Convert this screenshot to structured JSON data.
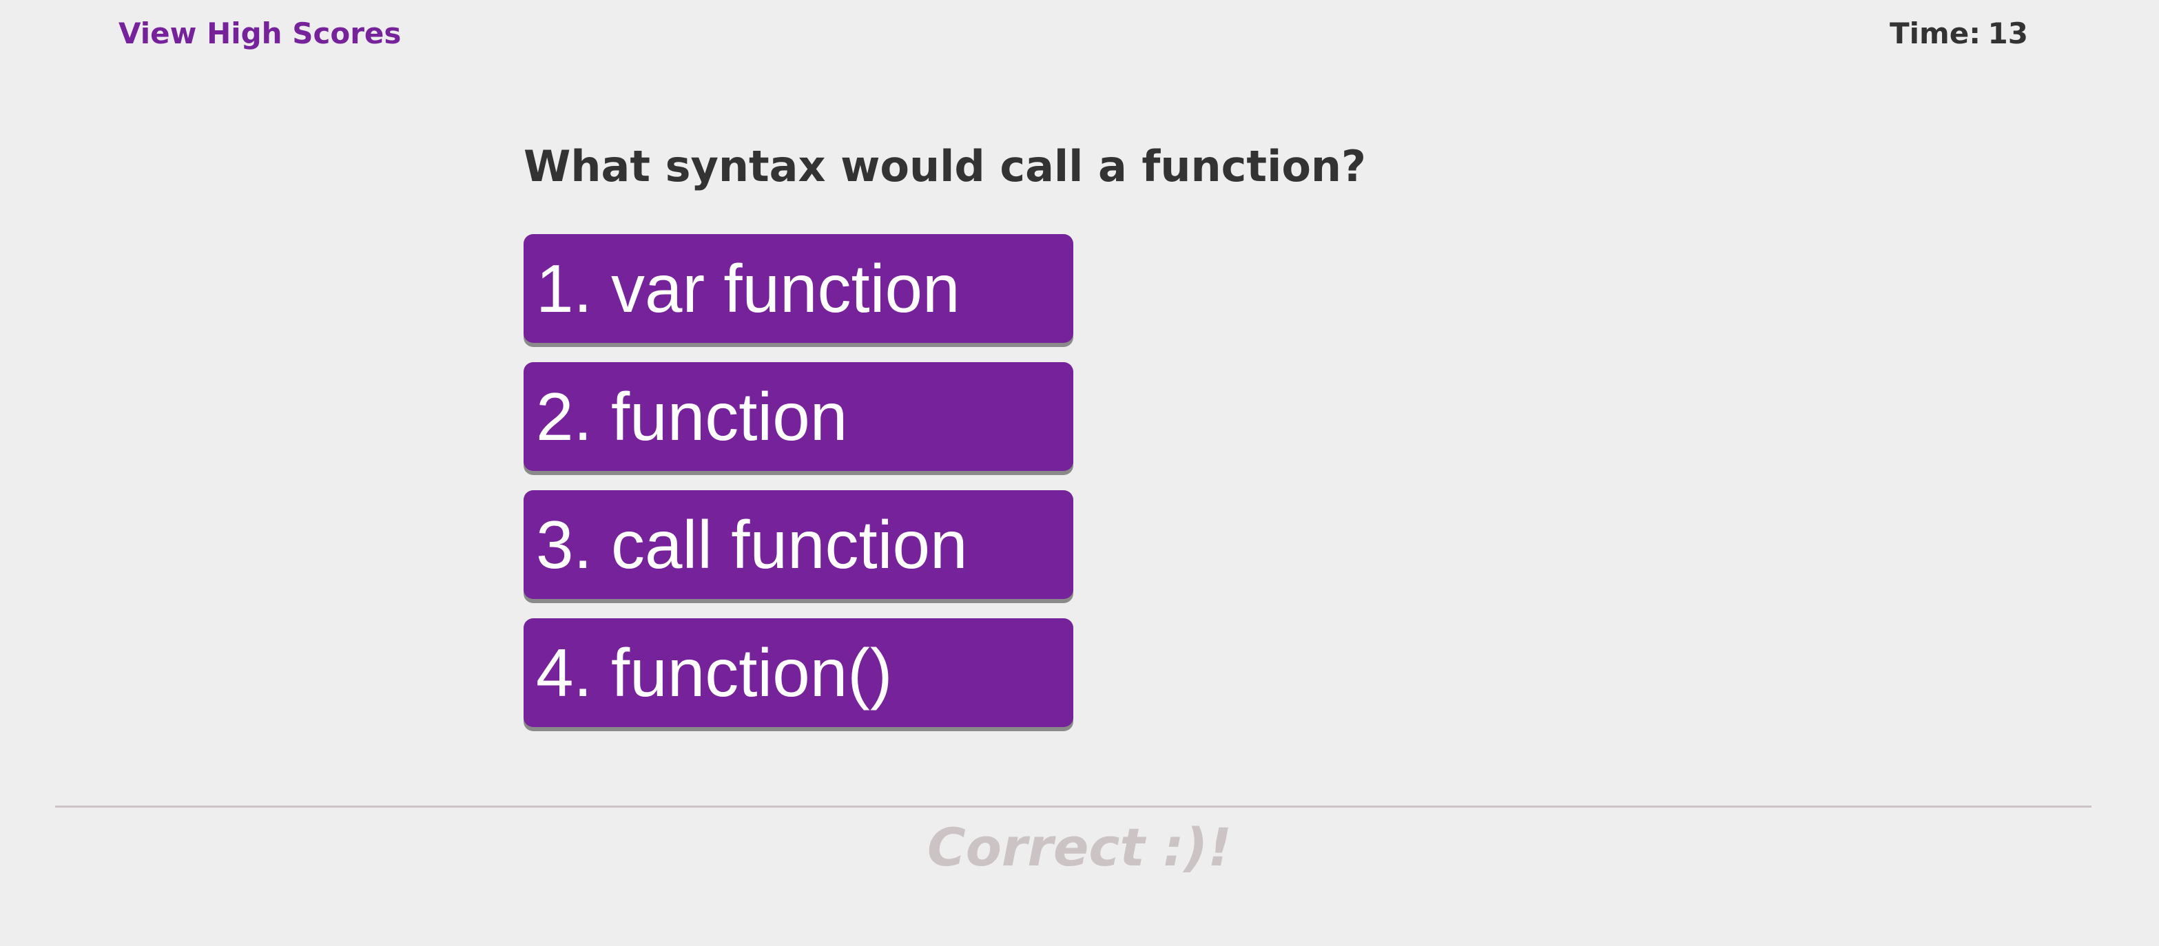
{
  "header": {
    "high_scores_label": "View High Scores",
    "timer_label": "Time:",
    "timer_value": "13"
  },
  "quiz": {
    "question": "What syntax would call a function?",
    "choices": [
      {
        "label": "1. var function"
      },
      {
        "label": "2. function"
      },
      {
        "label": "3. call function"
      },
      {
        "label": "4. function()"
      }
    ]
  },
  "feedback": {
    "text": "Correct :)!"
  },
  "colors": {
    "accent": "#76229a",
    "background": "#eeeeee",
    "text": "#333333",
    "feedback": "#cbc3c4"
  }
}
